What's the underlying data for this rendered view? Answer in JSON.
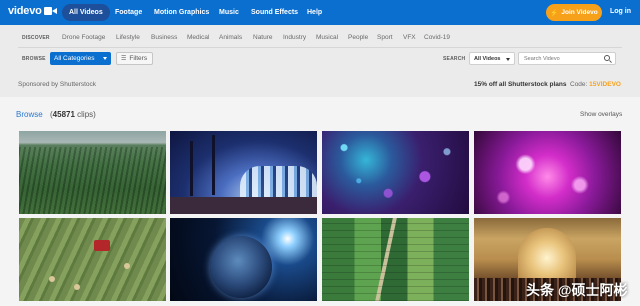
{
  "nav": {
    "logo": "videvo",
    "items": [
      "All Videos",
      "Footage",
      "Motion Graphics",
      "Music",
      "Sound Effects",
      "Help"
    ],
    "join": "Join Videvo",
    "login": "Log in"
  },
  "discover": {
    "label": "DISCOVER",
    "categories": [
      "Drone Footage",
      "Lifestyle",
      "Business",
      "Medical",
      "Animals",
      "Nature",
      "Industry",
      "Musical",
      "People",
      "Sport",
      "VFX",
      "Covid-19"
    ]
  },
  "browse_controls": {
    "label": "BROWSE",
    "category_select": "All Categories",
    "filters": "Filters",
    "search_label": "SEARCH",
    "type_select": "All Videos",
    "search_placeholder": "Search Videvo"
  },
  "sponsor": {
    "text": "Sponsored by Shutterstock",
    "promo": "15% off all Shutterstock plans",
    "code_label": "Code:",
    "code": "15VIDEVO"
  },
  "results": {
    "browse_link": "Browse",
    "count": "(45871 clips)",
    "count_number": "45871",
    "show_overlays": "Show overlays"
  },
  "thumbnails": [
    "forest-aerial",
    "night-street-palms",
    "purple-bokeh-particles",
    "pink-bokeh-lights",
    "tractor-hay-field",
    "earth-from-space",
    "green-farm-fields",
    "grand-central-crowd"
  ],
  "watermark": "头条 @硕士阿彬",
  "colors": {
    "nav_bg": "#0b6fd0",
    "join_bg": "#f7a11a",
    "link": "#2a78d2"
  }
}
